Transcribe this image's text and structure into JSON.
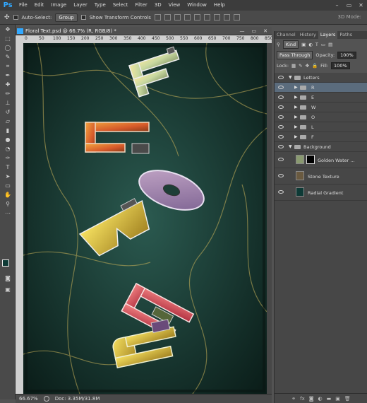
{
  "app": {
    "logo": "Ps",
    "menus": [
      "File",
      "Edit",
      "Image",
      "Layer",
      "Type",
      "Select",
      "Filter",
      "3D",
      "View",
      "Window",
      "Help"
    ],
    "window_controls": [
      "–",
      "▭",
      "✕"
    ]
  },
  "options": {
    "auto_select_label": "Auto-Select:",
    "auto_select_value": "Group",
    "show_transform_label": "Show Transform Controls",
    "mode_3d": "3D Mode:"
  },
  "document": {
    "title": "Floral Text.psd @ 66.7% (R, RGB/8) *",
    "controls": [
      "—",
      "▭",
      "✕"
    ],
    "ruler_marks": [
      "0",
      "50",
      "100",
      "150",
      "200",
      "250",
      "300",
      "350",
      "400",
      "450",
      "500",
      "550",
      "600",
      "650",
      "700",
      "750",
      "800",
      "850"
    ]
  },
  "status": {
    "zoom": "66.67%",
    "doc": "Doc: 3.35M/31.8M"
  },
  "panel": {
    "tabs": [
      "Channel",
      "History",
      "Layers",
      "Paths"
    ],
    "active_tab": "Layers",
    "kind": "Kind",
    "blend_mode": "Pass Through",
    "opacity_label": "Opacity:",
    "opacity": "100%",
    "lock_label": "Lock:",
    "fill_label": "Fill:",
    "fill": "100%",
    "layers": [
      {
        "name": "Letters",
        "type": "group",
        "open": true,
        "selected": false
      },
      {
        "name": "R",
        "type": "group",
        "selected": true
      },
      {
        "name": "E",
        "type": "group",
        "selected": false
      },
      {
        "name": "W",
        "type": "group",
        "selected": false
      },
      {
        "name": "O",
        "type": "group",
        "selected": false
      },
      {
        "name": "L",
        "type": "group",
        "selected": false
      },
      {
        "name": "F",
        "type": "group",
        "selected": false
      },
      {
        "name": "Background",
        "type": "group",
        "open": true,
        "selected": false
      },
      {
        "name": "Golden Water ...",
        "type": "masked",
        "selected": false
      },
      {
        "name": "Stone Texture",
        "type": "layer",
        "selected": false
      },
      {
        "name": "Radial Gradient",
        "type": "layer",
        "selected": false
      }
    ]
  },
  "colors": {
    "ps_blue": "#31a8ff",
    "selected_layer": "#5b6c7d",
    "canvas_base": "#1e3e37"
  },
  "canvas_letters": [
    "F",
    "L",
    "O",
    "W",
    "E",
    "R"
  ]
}
